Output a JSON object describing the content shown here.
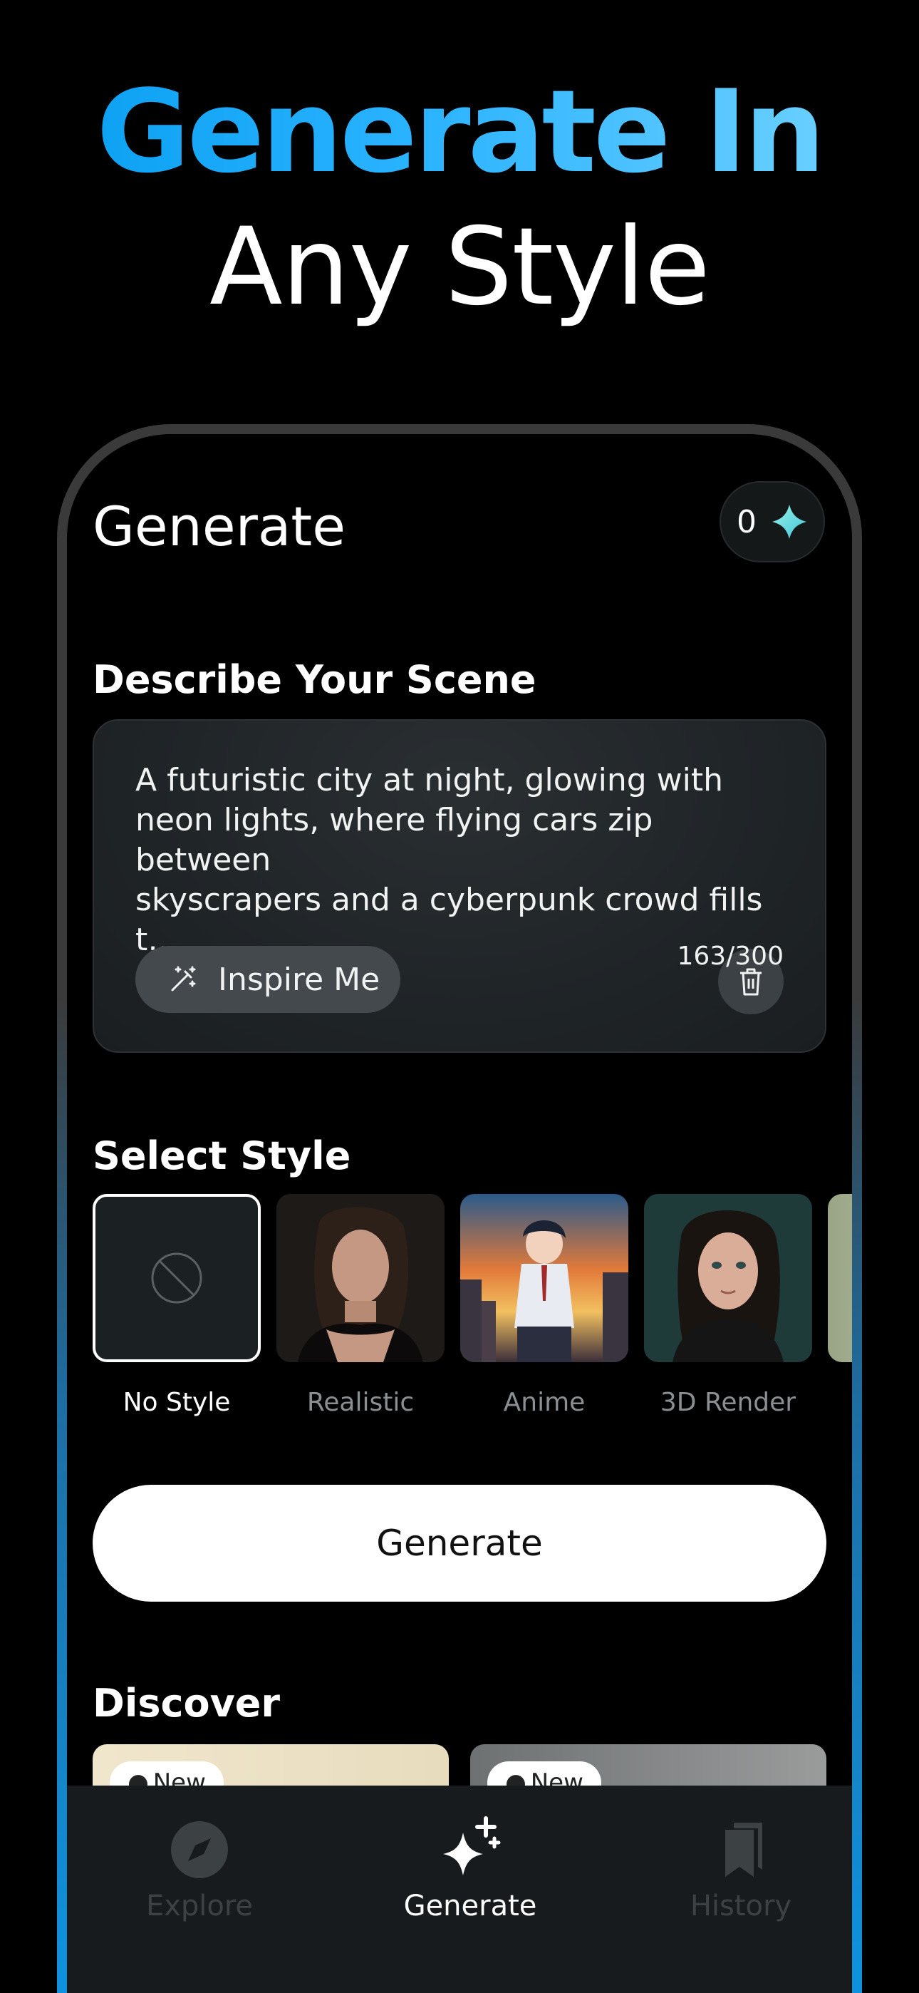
{
  "hero": {
    "line1": "Generate In",
    "line2": "Any Style"
  },
  "header": {
    "title": "Generate",
    "credits": "0",
    "credit_icon": "gem-icon"
  },
  "prompt": {
    "section_label": "Describe Your Scene",
    "text": "A futuristic city at night, glowing with\nneon lights, where flying cars zip between\nskyscrapers and a cyberpunk crowd fills t…",
    "char_count": "163/300",
    "inspire_label": "Inspire Me",
    "inspire_icon": "magic-wand-icon",
    "clear_icon": "trash-icon"
  },
  "styles": {
    "section_label": "Select Style",
    "selected": "No Style",
    "items": [
      {
        "label": "No Style"
      },
      {
        "label": "Realistic"
      },
      {
        "label": "Anime"
      },
      {
        "label": "3D Render"
      }
    ]
  },
  "generate_button": {
    "label": "Generate"
  },
  "discover": {
    "section_label": "Discover",
    "badge": "New"
  },
  "nav": {
    "active": "Generate",
    "items": [
      {
        "label": "Explore",
        "icon": "compass-icon"
      },
      {
        "label": "Generate",
        "icon": "sparkles-icon"
      },
      {
        "label": "History",
        "icon": "bookmarks-icon"
      }
    ]
  },
  "colors": {
    "background": "#000000",
    "accent_blue": "#0ea2f3",
    "card": "#1f2427",
    "nav_background": "#171b1d"
  }
}
